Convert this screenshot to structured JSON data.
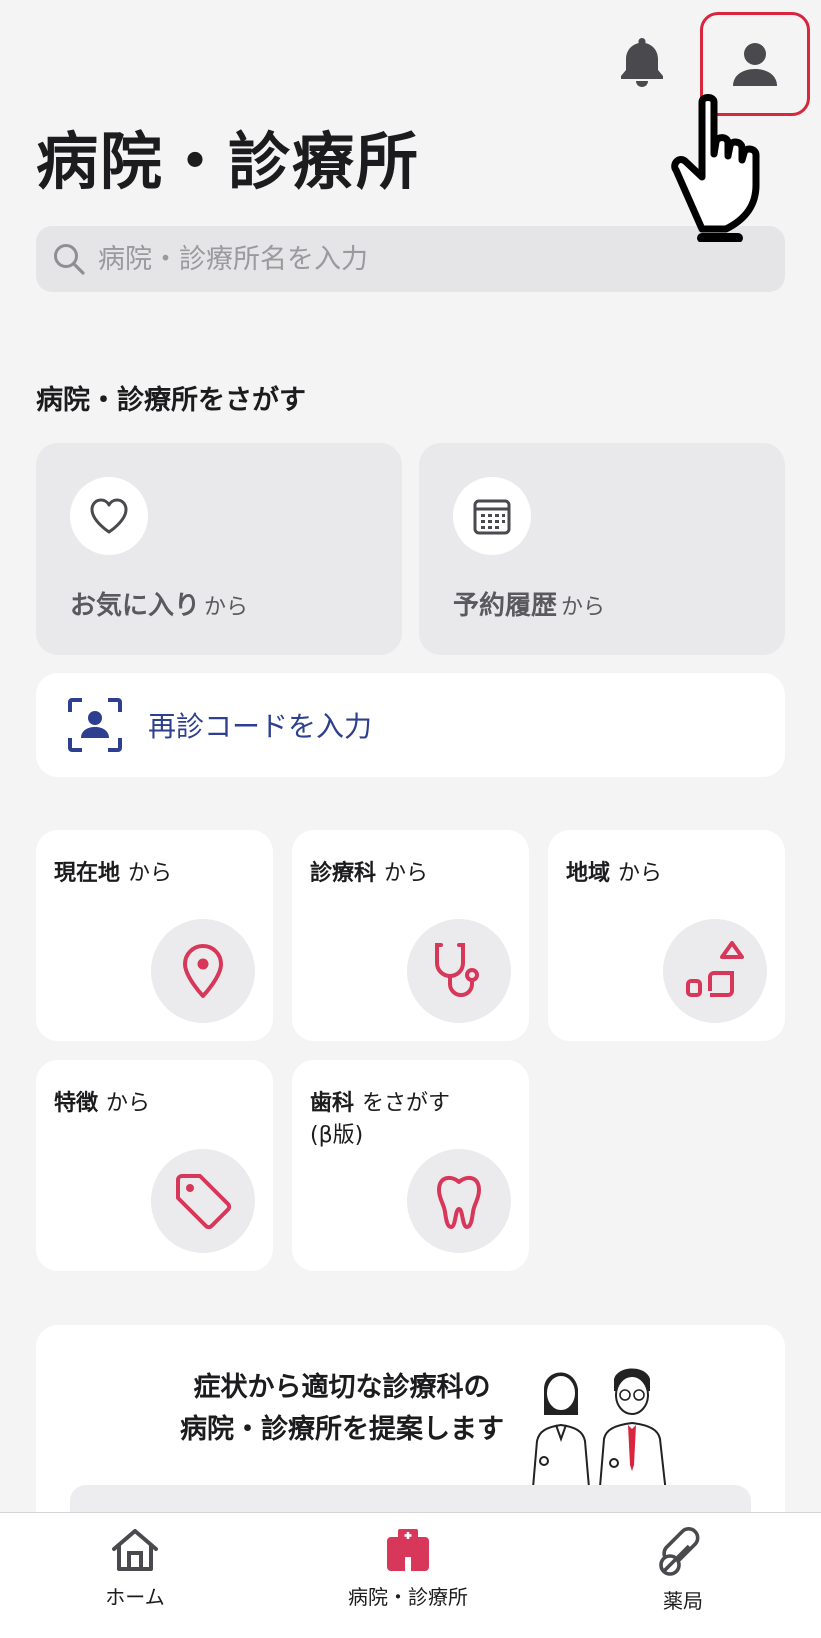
{
  "header": {
    "title": "病院・診療所",
    "search_placeholder": "病院・診療所名を入力",
    "notification_icon": "bell-icon",
    "account_icon": "person-icon"
  },
  "find_section": {
    "title": "病院・診療所をさがす",
    "favorites": {
      "label": "お気に入り",
      "suffix": "から",
      "icon": "heart-icon"
    },
    "history": {
      "label": "予約履歴",
      "suffix": "から",
      "icon": "calendar-icon"
    }
  },
  "revisit_code": {
    "label": "再診コードを入力",
    "icon": "scan-person-icon"
  },
  "search_tiles": [
    {
      "label": "現在地",
      "suffix": "から",
      "icon": "location-pin-icon"
    },
    {
      "label": "診療科",
      "suffix": "から",
      "icon": "stethoscope-icon"
    },
    {
      "label": "地域",
      "suffix": "から",
      "icon": "region-map-icon"
    },
    {
      "label": "特徴",
      "suffix": "から",
      "icon": "tag-icon"
    },
    {
      "label": "歯科",
      "suffix": "をさがす",
      "line2": "(β版)",
      "icon": "tooth-icon"
    }
  ],
  "symptom_banner": {
    "line1": "症状から適切な診療科の",
    "line2": "病院・診療所を提案します"
  },
  "bottom_nav": [
    {
      "label": "ホーム",
      "icon": "home-icon"
    },
    {
      "label": "病院・診療所",
      "icon": "hospital-icon",
      "active": true
    },
    {
      "label": "薬局",
      "icon": "pill-icon"
    }
  ],
  "colors": {
    "accent": "#d7385a",
    "link": "#2e3f8f",
    "highlight": "#d7263d"
  }
}
